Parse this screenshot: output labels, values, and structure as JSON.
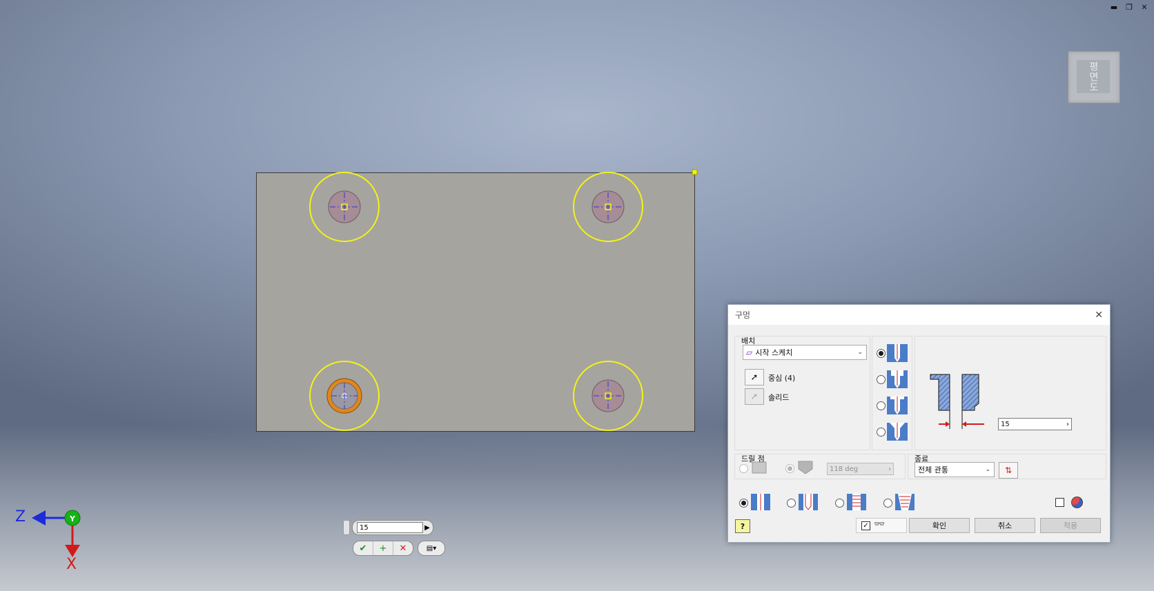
{
  "window_controls": {
    "minimize": "▬",
    "restore": "❐",
    "close": "✕"
  },
  "viewcube": {
    "face_label": "평면도"
  },
  "axes": {
    "z_label": "Z",
    "x_label": "X"
  },
  "mini_toolbar": {
    "value": "15",
    "arrow": "▶",
    "ok_glyph": "✔",
    "add_glyph": "+",
    "cancel_glyph": "✕",
    "options_glyph": "▤▾"
  },
  "dialog": {
    "title": "구멍",
    "close_glyph": "✕",
    "placement": {
      "label": "배치",
      "dropdown_value": "시작 스케치",
      "centers_label": "중심 (4)",
      "solid_label": "솔리드"
    },
    "hole_types": [
      {
        "name": "drilled",
        "selected": true
      },
      {
        "name": "counterbore",
        "selected": false
      },
      {
        "name": "spotface",
        "selected": false
      },
      {
        "name": "countersink",
        "selected": false
      }
    ],
    "diameter_value": "15",
    "drill_point": {
      "label": "드릴 점",
      "angle": "118 deg",
      "flat_selected": false,
      "angle_selected": true
    },
    "termination": {
      "label": "종료",
      "value": "전체 관통"
    },
    "thread_types": [
      {
        "name": "simple",
        "selected": true
      },
      {
        "name": "clearance",
        "selected": false
      },
      {
        "name": "tapped",
        "selected": false
      },
      {
        "name": "taper-tapped",
        "selected": false
      }
    ],
    "buttons": {
      "ok": "확인",
      "cancel": "취소",
      "apply": "적용"
    },
    "preview_checked": true,
    "help_glyph": "?"
  },
  "colors": {
    "highlight_yellow": "#f2f21a",
    "hole_fill": "#a58c96",
    "selected_orange": "#e0871c",
    "axis_z": "#1d2bd8",
    "axis_y": "#16b316",
    "axis_x": "#d11b1b"
  }
}
